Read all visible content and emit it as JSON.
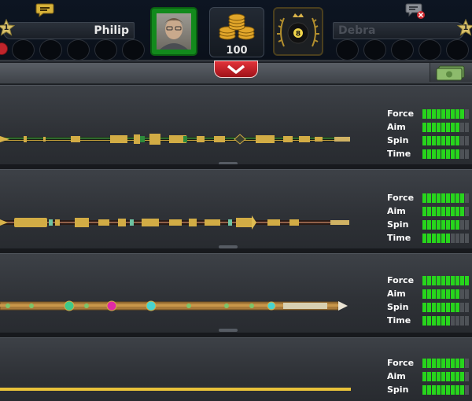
{
  "players": {
    "left": {
      "name": "Philip",
      "level": "1",
      "slots_count": 5
    },
    "right": {
      "name": "Debra",
      "level": "1",
      "slots_count": 5
    }
  },
  "pot": {
    "value": "100"
  },
  "icons": {
    "chat_left": "chat-bubble-icon",
    "chat_right": "chat-muted-icon",
    "pot": "coin-stack-icon",
    "opponent": "eight-ball-icon",
    "dropdown": "chevron-down-icon",
    "cash": "cash-icon"
  },
  "colors": {
    "stat_filled": "#27d51c",
    "stat_empty": "#4e5257",
    "dropdown_red": "#d21f27",
    "avatar_green": "#128a1c"
  },
  "stat_max": 10,
  "cues": [
    {
      "name_visible": false,
      "stats": [
        {
          "label": "Force",
          "value": 9
        },
        {
          "label": "Aim",
          "value": 8
        },
        {
          "label": "Spin",
          "value": 8
        },
        {
          "label": "Time",
          "value": 8
        }
      ]
    },
    {
      "name_visible": false,
      "stats": [
        {
          "label": "Force",
          "value": 9
        },
        {
          "label": "Aim",
          "value": 9
        },
        {
          "label": "Spin",
          "value": 8
        },
        {
          "label": "Time",
          "value": 6
        }
      ]
    },
    {
      "name_visible": false,
      "stats": [
        {
          "label": "Force",
          "value": 10
        },
        {
          "label": "Aim",
          "value": 8
        },
        {
          "label": "Spin",
          "value": 8
        },
        {
          "label": "Time",
          "value": 6
        }
      ]
    },
    {
      "name_visible": false,
      "stats": [
        {
          "label": "Force",
          "value": 9
        },
        {
          "label": "Aim",
          "value": 9
        },
        {
          "label": "Spin",
          "value": 9
        }
      ]
    }
  ]
}
